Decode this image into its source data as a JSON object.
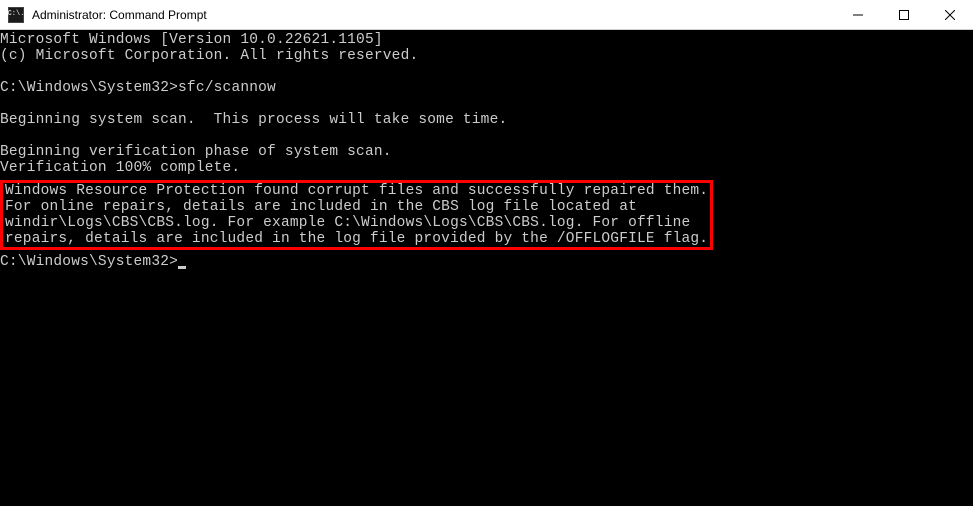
{
  "window": {
    "title": "Administrator: Command Prompt",
    "icon_label": "C:\\."
  },
  "terminal": {
    "line1": "Microsoft Windows [Version 10.0.22621.1105]",
    "line2": "(c) Microsoft Corporation. All rights reserved.",
    "prompt1_path": "C:\\Windows\\System32>",
    "prompt1_cmd": "sfc/scannow",
    "line3": "Beginning system scan.  This process will take some time.",
    "line4": "Beginning verification phase of system scan.",
    "line5": "Verification 100% complete.",
    "boxed": {
      "b1": "Windows Resource Protection found corrupt files and successfully repaired them.",
      "b2": "For online repairs, details are included in the CBS log file located at",
      "b3": "windir\\Logs\\CBS\\CBS.log. For example C:\\Windows\\Logs\\CBS\\CBS.log. For offline",
      "b4": "repairs, details are included in the log file provided by the /OFFLOGFILE flag."
    },
    "prompt2_path": "C:\\Windows\\System32>"
  }
}
